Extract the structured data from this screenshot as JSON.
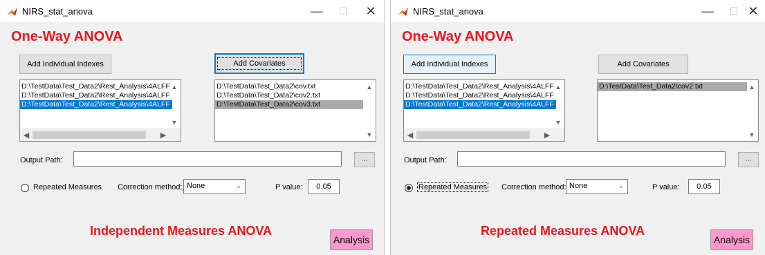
{
  "windows": [
    {
      "title": "NIRS_stat_anova",
      "controls": {
        "minimize": "—",
        "maximize": "☐",
        "close": "✕"
      },
      "heading": "One-Way ANOVA",
      "add_indexes_label": "Add Individual Indexes",
      "add_covariates_label": "Add Covariates",
      "indexes_list": [
        "D:\\TestData\\Test_Data2\\Rest_Analysis\\4ALFF",
        "D:\\TestData\\Test_Data2\\Rest_Analysis\\4ALFF",
        "D:\\TestData\\Test_Data2\\Rest_Analysis\\4ALFF"
      ],
      "covariates_list": [
        "D:\\TestData\\Test_Data2\\cov.txt",
        "D:\\TestData\\Test_Data2\\cov2.txt",
        "D:\\TestData\\Test_Data2\\cov3.txt"
      ],
      "output_path_label": "Output Path:",
      "output_path_value": "",
      "browse_label": "...",
      "repeated_measures_label": "Repeated Measures",
      "repeated_measures_checked": false,
      "correction_label": "Correction method:",
      "correction_value": "None",
      "pvalue_label": "P value:",
      "pvalue_value": "0.05",
      "annotation": "Independent Measures ANOVA",
      "analysis_label": "Analysis"
    },
    {
      "title": "NIRS_stat_anova",
      "controls": {
        "minimize": "—",
        "maximize": "☐",
        "close": "✕"
      },
      "heading": "One-Way ANOVA",
      "add_indexes_label": "Add Individual Indexes",
      "add_covariates_label": "Add Covariates",
      "indexes_list": [
        "D:\\TestData\\Test_Data2\\Rest_Analysis\\4ALFF",
        "D:\\TestData\\Test_Data2\\Rest_Analysis\\4ALFF",
        "D:\\TestData\\Test_Data2\\Rest_Analysis\\4ALFF"
      ],
      "covariates_list": [
        "D:\\TestData\\Test_Data2\\cov2.txt"
      ],
      "output_path_label": "Output Path:",
      "output_path_value": "",
      "browse_label": "...",
      "repeated_measures_label": "Repeated Measures",
      "repeated_measures_checked": true,
      "correction_label": "Correction method:",
      "correction_value": "None",
      "pvalue_label": "P value:",
      "pvalue_value": "0.05",
      "annotation": "Repeated  Measures ANOVA",
      "analysis_label": "Analysis"
    }
  ],
  "colors": {
    "heading_red": "#e8161f",
    "selection_blue": "#0078d7",
    "selection_gray": "#aaaaaa",
    "analysis_pink": "#ff99cc",
    "window_bg": "#f0f0f0"
  },
  "icons": {
    "app_icon": "matlab-logo-icon",
    "scroll_up": "▲",
    "scroll_down": "▼",
    "scroll_left": "◀",
    "scroll_right": "▶",
    "dropdown_arrow": "chevron-down-icon"
  }
}
